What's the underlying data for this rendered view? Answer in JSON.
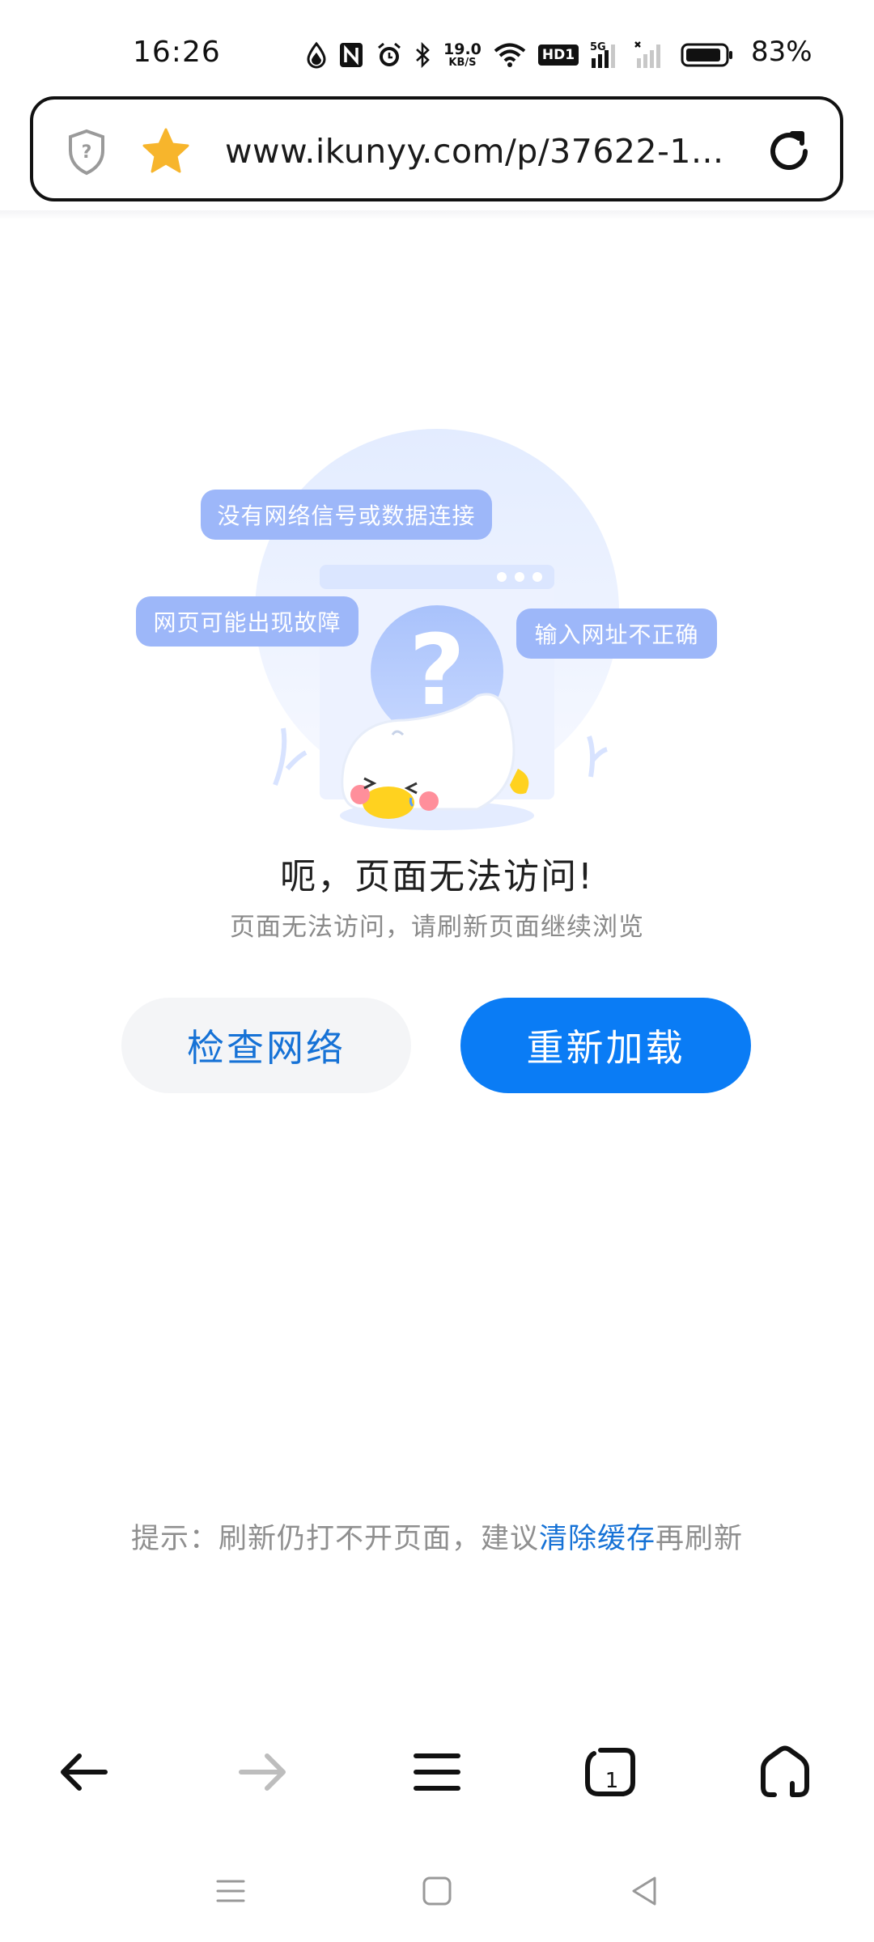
{
  "status_bar": {
    "time": "16:26",
    "net_speed_value": "19.0",
    "net_speed_unit": "KB/S",
    "hd_label": "HD1",
    "signal_label": "5G",
    "battery_percent": "83%",
    "icons": [
      "data-saver-icon",
      "nfc-icon",
      "alarm-icon",
      "bluetooth-icon",
      "wifi-icon",
      "signal-icon",
      "signal-x-icon",
      "battery-icon"
    ]
  },
  "url_bar": {
    "url": "www.ikunyy.com/p/37622-1..."
  },
  "error": {
    "bubbles": [
      "没有网络信号或数据连接",
      "网页可能出现故障",
      "输入网址不正确"
    ],
    "title": "呃，页面无法访问!",
    "subtitle": "页面无法访问，请刷新页面继续浏览"
  },
  "buttons": {
    "check_network": "检查网络",
    "reload": "重新加载"
  },
  "hint": {
    "prefix": "提示：刷新仍打不开页面，建议",
    "link": "清除缓存",
    "suffix": "再刷新"
  },
  "toolbar": {
    "tabs_count": "1",
    "items": [
      "back-icon",
      "forward-icon",
      "menu-icon",
      "tabs-icon",
      "home-icon"
    ]
  },
  "colors": {
    "accent": "#0a7cf5",
    "link": "#1672d6",
    "bubble": "#9db7f9",
    "star": "#f7b52c"
  }
}
